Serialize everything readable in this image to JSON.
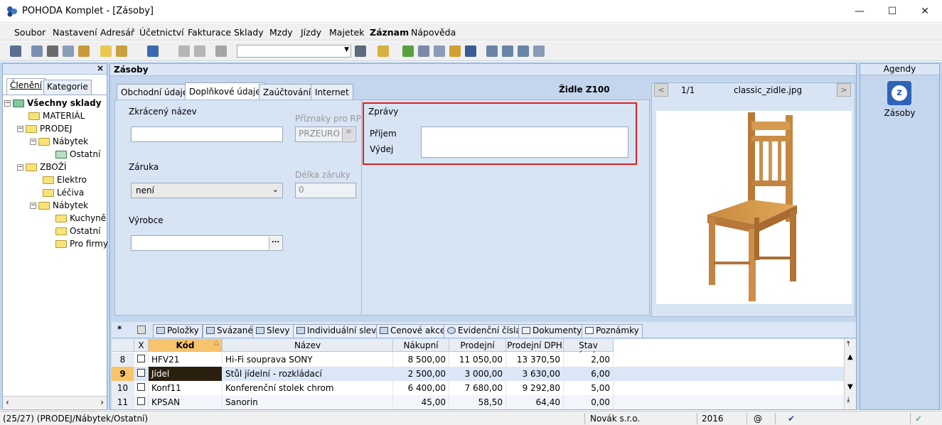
{
  "window": {
    "title": "POHODA Komplet - [Zásoby]",
    "minimize": "—",
    "maximize": "☐",
    "close": "✕"
  },
  "menu": [
    "Soubor",
    "Nastavení",
    "Adresář",
    "Účetnictví",
    "Fakturace",
    "Sklady",
    "Mzdy",
    "Jízdy",
    "Majetek",
    "Záznam",
    "Nápověda"
  ],
  "left": {
    "close": "×",
    "tabs": [
      "Členění",
      "Kategorie"
    ],
    "tree": {
      "root": "Všechny sklady",
      "items": [
        "MATERIÁL",
        "PRODEJ",
        "Nábytek",
        "Ostatní",
        "ZBOŽÍ",
        "Elektro",
        "Léčiva",
        "Nábytek",
        "Kuchyně",
        "Ostatní",
        "Pro firmy"
      ]
    }
  },
  "main": {
    "header": "Zásoby",
    "tabs": [
      "Obchodní údaje",
      "Doplňkové údaje",
      "Zaúčtování",
      "Internet"
    ],
    "record_title": "Židle Z100",
    "form": {
      "short_name_label": "Zkrácený název",
      "short_name_value": "",
      "flags_label": "Příznaky pro RP",
      "flags_value": "PRZEURO",
      "warranty_label": "Záruka",
      "warranty_value": "není",
      "warranty_length_label": "Délka záruky",
      "warranty_length_value": "0",
      "manufacturer_label": "Výrobce",
      "manufacturer_value": "",
      "browse": "..."
    },
    "messages": {
      "title": "Zprávy",
      "receipt": "Příjem",
      "issue": "Výdej",
      "text": ""
    },
    "image": {
      "prev": "<",
      "next": ">",
      "counter": "1/1",
      "filename": "classic_zidle.jpg"
    }
  },
  "agenda": {
    "header": "Agendy",
    "item": "Zásoby"
  },
  "subtabs": {
    "star": "*",
    "items": [
      "Položky",
      "Svázané",
      "Slevy",
      "Individuální slevy",
      "Cenové akce",
      "Evidenční čísla",
      "Dokumenty",
      "Poznámky"
    ]
  },
  "grid": {
    "columns": [
      "X",
      "Kód",
      "Název",
      "Nákupní",
      "Prodejní",
      "Prodejní DPH",
      "Stav zásoby"
    ],
    "rows": [
      {
        "num": "8",
        "code": "HFV21",
        "name": "Hi-Fi souprava SONY",
        "buy": "8 500,00",
        "sell": "11 050,00",
        "sell_vat": "13 370,50",
        "stock": "2,00"
      },
      {
        "num": "9",
        "code": "Jídel",
        "name": "Stůl jídelní - rozkládací",
        "buy": "2 500,00",
        "sell": "3 000,00",
        "sell_vat": "3 630,00",
        "stock": "6,00"
      },
      {
        "num": "10",
        "code": "Konf11",
        "name": "Konferenční stolek chrom",
        "buy": "6 400,00",
        "sell": "7 680,00",
        "sell_vat": "9 292,80",
        "stock": "5,00"
      },
      {
        "num": "11",
        "code": "KPSAN",
        "name": "Sanorin",
        "buy": "45,00",
        "sell": "58,50",
        "sell_vat": "64,40",
        "stock": "0,00"
      }
    ]
  },
  "status": {
    "path": "(25/27) (PRODEJ/Nábytek/Ostatní)",
    "company": "Novák s.r.o.",
    "year": "2016",
    "at": "@"
  },
  "colors": {
    "workspace": "#c3d6ee",
    "highlight": "#e02020",
    "selected_row_code_bg": "#2b2010",
    "sort_header": "#f7c46b"
  }
}
